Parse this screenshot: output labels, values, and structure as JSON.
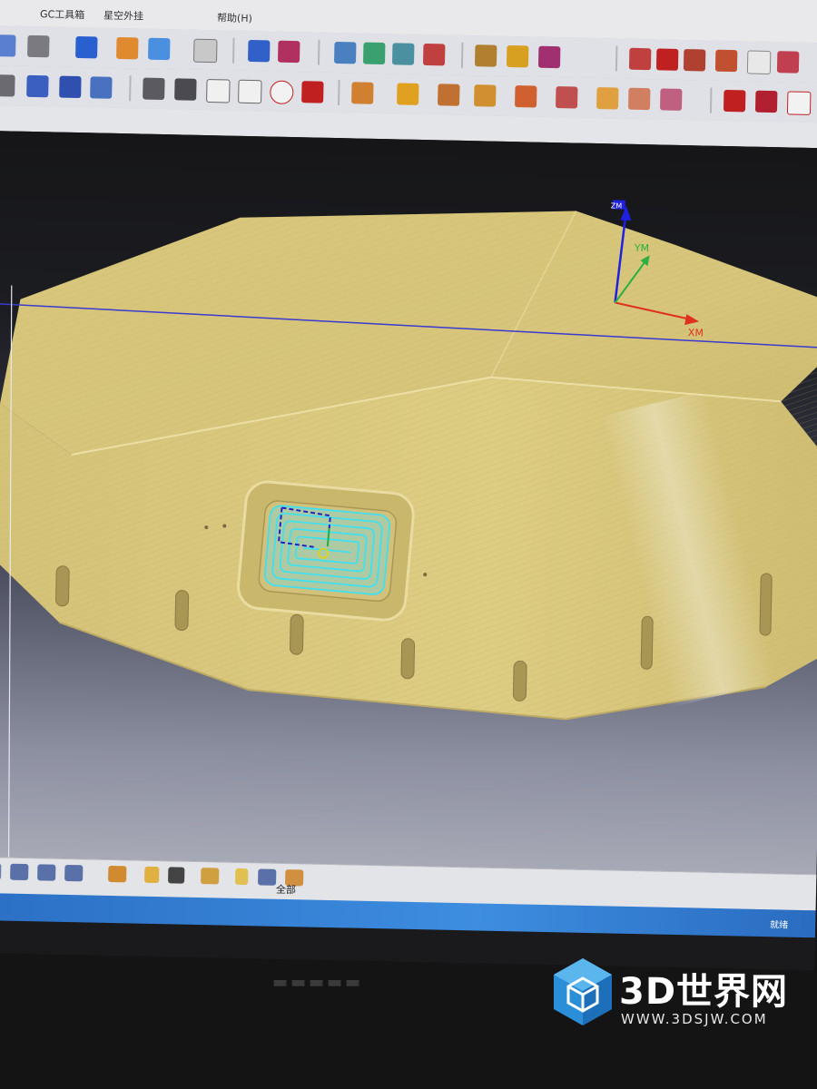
{
  "menu": {
    "items": [
      "GC工具箱",
      "星空外挂",
      "帮助(H)"
    ]
  },
  "statusbar": {
    "filter_label": "全部",
    "right_text": "就绪"
  },
  "viewport": {
    "axis_labels": {
      "x": "XM",
      "y": "YM",
      "z": "ZM"
    }
  },
  "watermark": {
    "title": "3D世界网",
    "url": "WWW.3DSJW.COM"
  },
  "colors": {
    "part": "#d8c77a",
    "toolpath": "#40e0f0",
    "axis_x": "#e0301e",
    "axis_y": "#2ab040",
    "axis_z": "#2020e0"
  }
}
